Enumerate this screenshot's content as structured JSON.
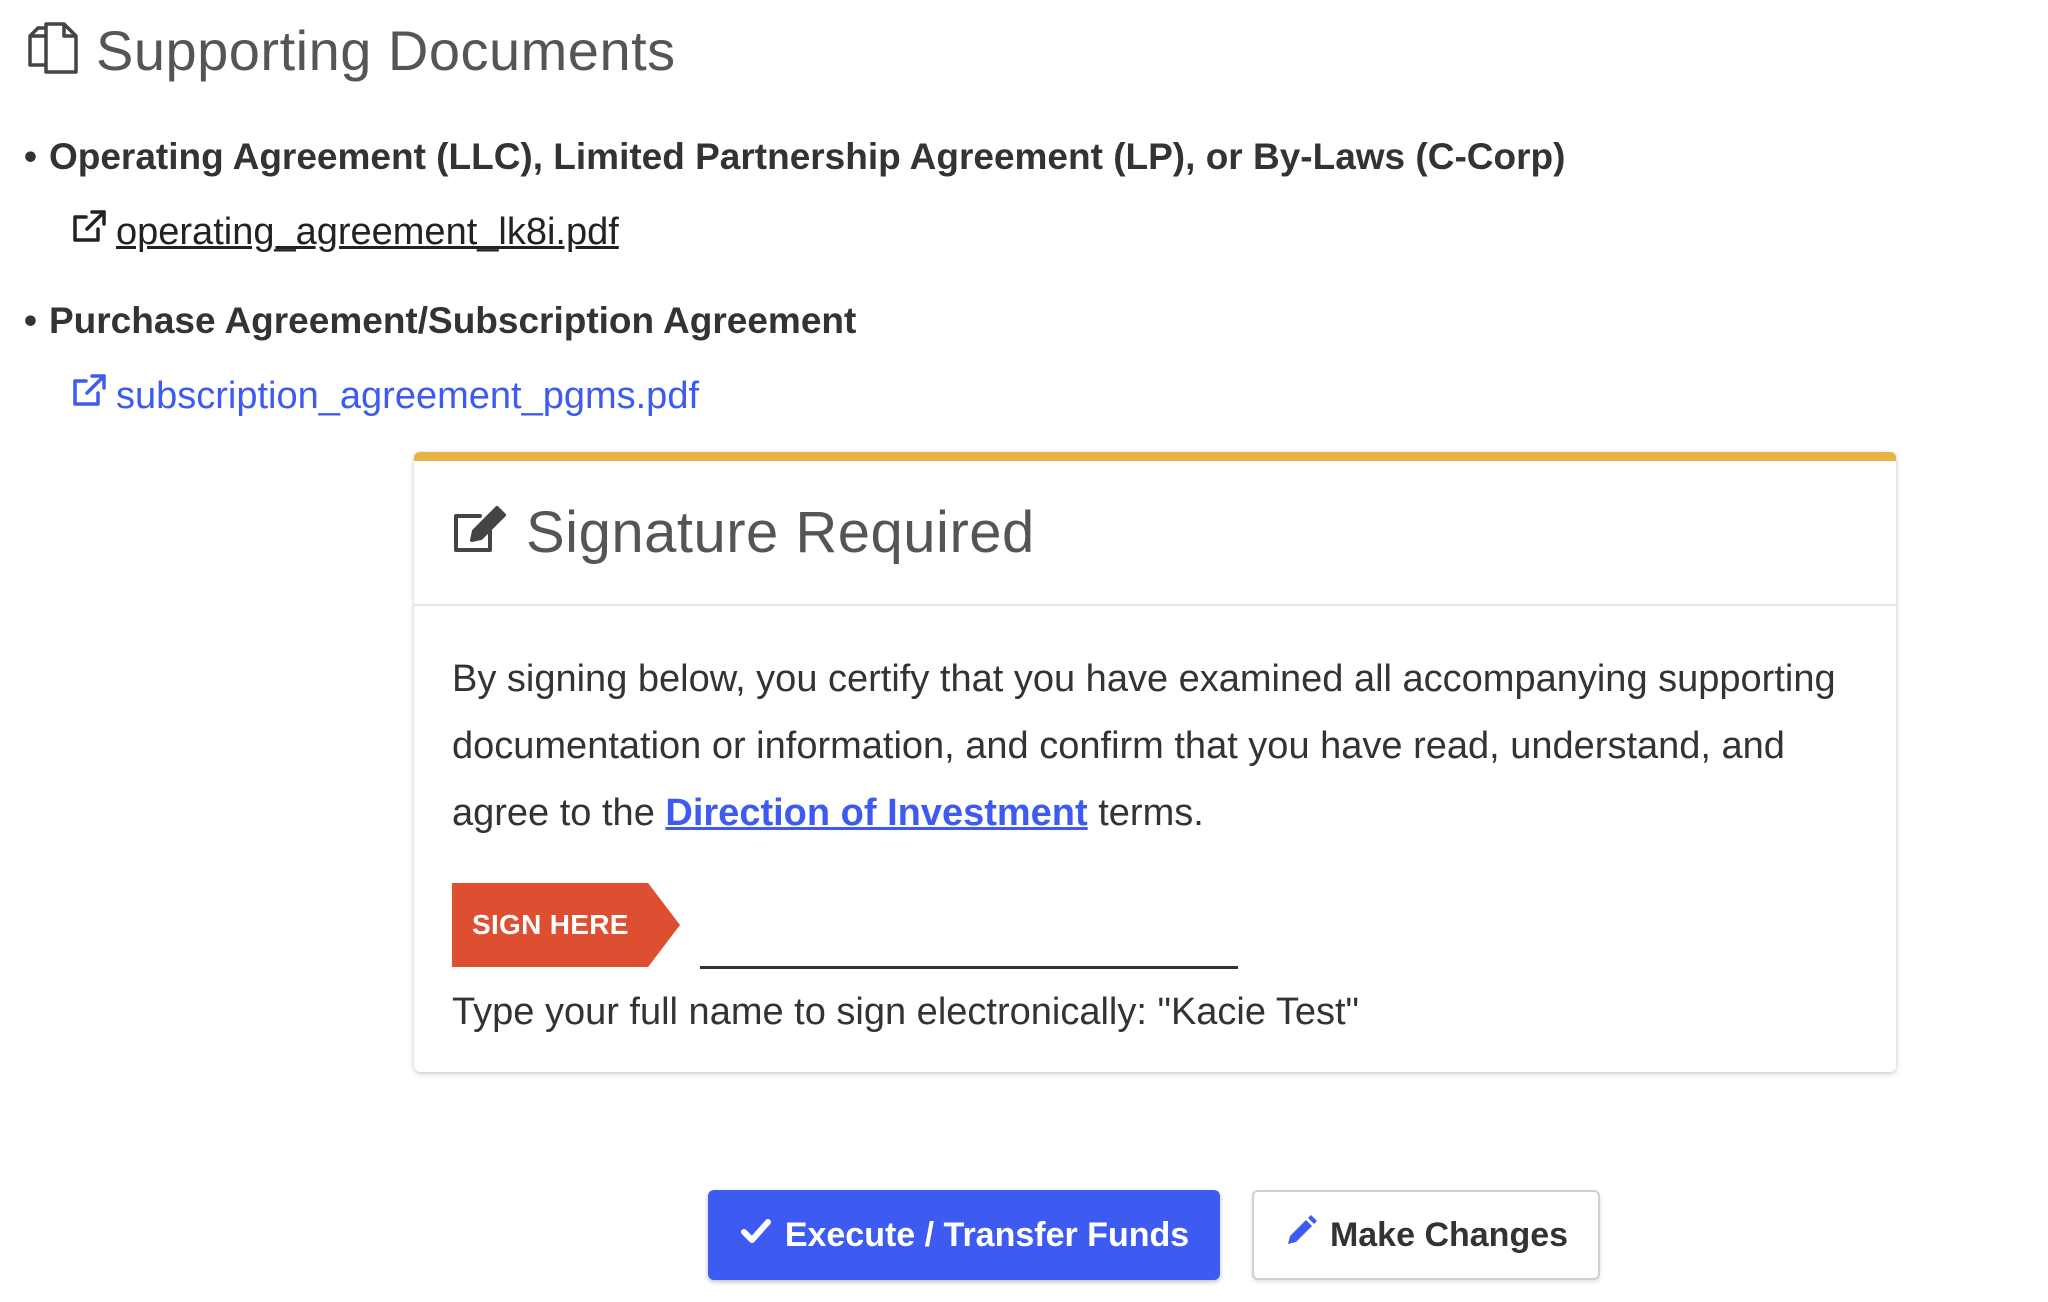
{
  "supporting_documents": {
    "title": "Supporting Documents",
    "icon": "copy-documents-icon",
    "items": [
      {
        "bullet": "•",
        "heading": "Operating Agreement (LLC), Limited Partnership Agreement (LP), or By-Laws (C-Corp)",
        "file": "operating_agreement_lk8i.pdf",
        "icon": "external-link-icon"
      },
      {
        "bullet": "•",
        "heading": "Purchase Agreement/Subscription Agreement",
        "file": "subscription_agreement_pgms.pdf",
        "icon": "external-link-icon"
      }
    ]
  },
  "signature": {
    "title": "Signature Required",
    "icon": "edit-square-icon",
    "accent_color": "#e5b443",
    "text_before": "By signing below, you certify that you have examined all accompanying supporting documentation or information, and confirm that you have read, understand, and agree to the ",
    "link_text": "Direction of Investment",
    "text_after": " terms.",
    "sign_here_label": "SIGN HERE",
    "sign_here_color": "#de4e31",
    "input_value": "",
    "hint": "Type your full name to sign electronically: \"Kacie Test\""
  },
  "actions": {
    "execute_label": "Execute / Transfer Funds",
    "execute_icon": "check-icon",
    "primary_color": "#3d5bf0",
    "changes_label": "Make Changes",
    "changes_icon": "pencil-icon"
  }
}
